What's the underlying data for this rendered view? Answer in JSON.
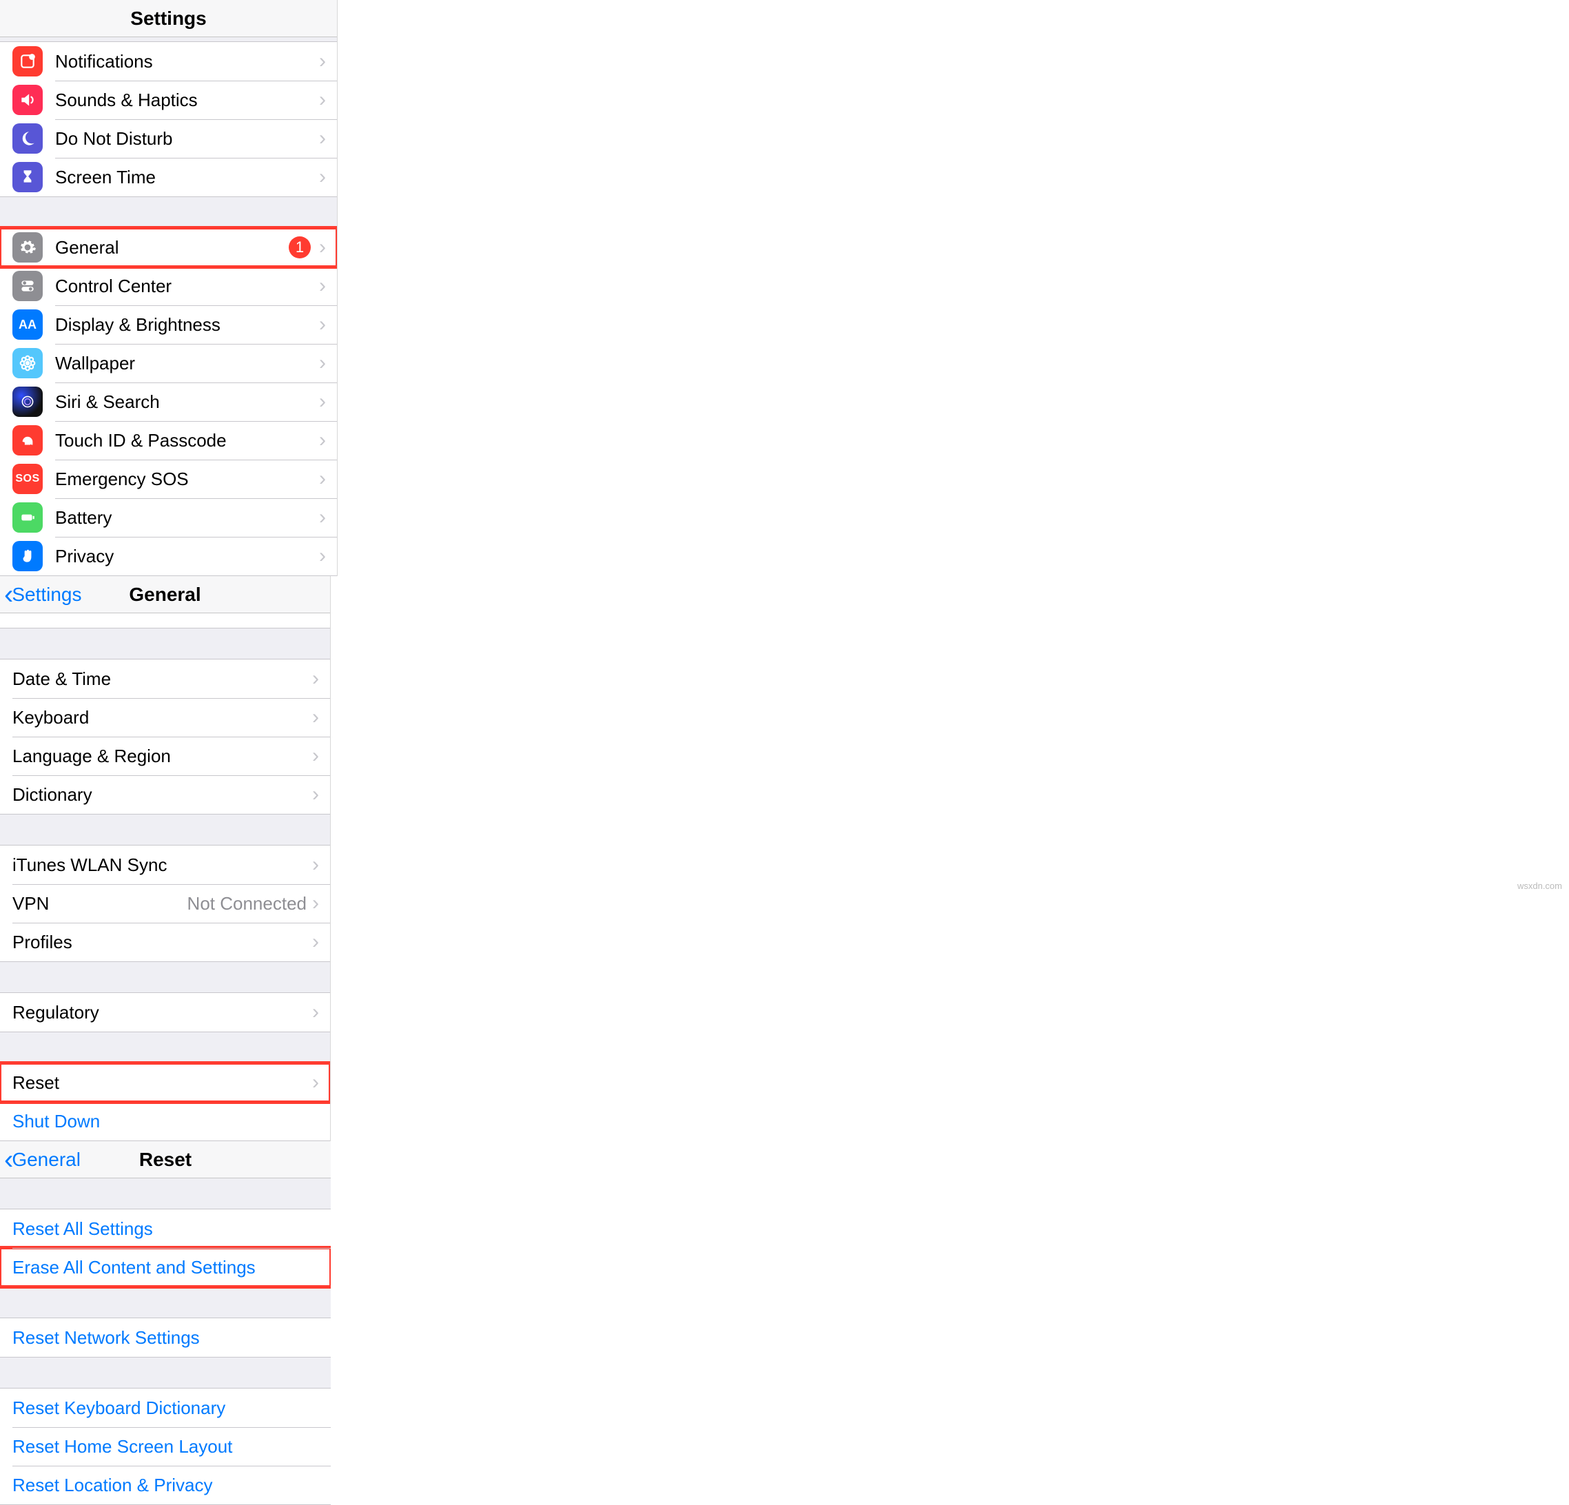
{
  "panel1": {
    "title": "Settings",
    "items": [
      {
        "label": "Notifications"
      },
      {
        "label": "Sounds & Haptics"
      },
      {
        "label": "Do Not Disturb"
      },
      {
        "label": "Screen Time"
      }
    ],
    "items2": [
      {
        "label": "General",
        "badge": "1"
      },
      {
        "label": "Control Center"
      },
      {
        "label": "Display & Brightness"
      },
      {
        "label": "Wallpaper"
      },
      {
        "label": "Siri & Search"
      },
      {
        "label": "Touch ID & Passcode"
      },
      {
        "label": "Emergency SOS",
        "sos": "SOS"
      },
      {
        "label": "Battery"
      },
      {
        "label": "Privacy"
      }
    ]
  },
  "panel2": {
    "back": "Settings",
    "title": "General",
    "groupA": [
      {
        "label": "Date & Time"
      },
      {
        "label": "Keyboard"
      },
      {
        "label": "Language & Region"
      },
      {
        "label": "Dictionary"
      }
    ],
    "groupB": [
      {
        "label": "iTunes WLAN Sync"
      },
      {
        "label": "VPN",
        "detail": "Not Connected"
      },
      {
        "label": "Profiles"
      }
    ],
    "groupC": [
      {
        "label": "Regulatory"
      }
    ],
    "groupD": [
      {
        "label": "Reset"
      },
      {
        "label": "Shut Down",
        "link": true
      }
    ]
  },
  "panel3": {
    "back": "General",
    "title": "Reset",
    "groupA": [
      {
        "label": "Reset All Settings"
      },
      {
        "label": "Erase All Content and Settings"
      }
    ],
    "groupB": [
      {
        "label": "Reset Network Settings"
      }
    ],
    "groupC": [
      {
        "label": "Reset Keyboard Dictionary"
      },
      {
        "label": "Reset Home Screen Layout"
      },
      {
        "label": "Reset Location & Privacy"
      }
    ]
  },
  "watermark": "wsxdn.com"
}
